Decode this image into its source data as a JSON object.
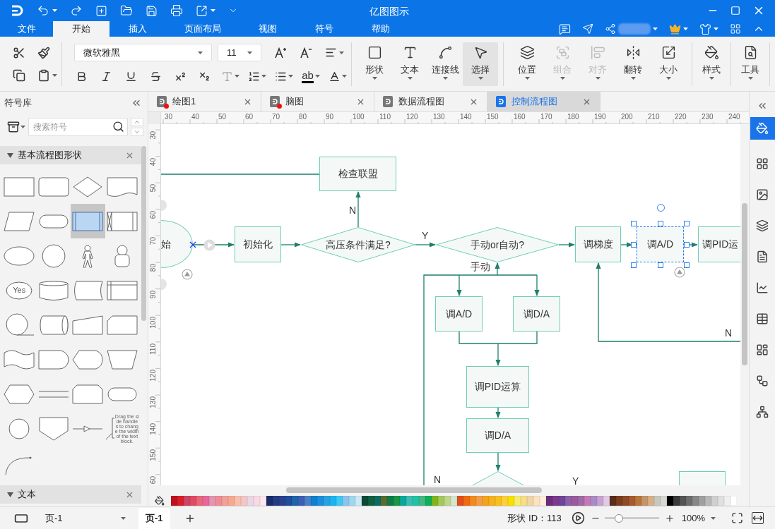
{
  "title_bar": {
    "title": "亿图图示"
  },
  "menu_tabs": [
    {
      "label": "文件",
      "selected": false
    },
    {
      "label": "开始",
      "selected": true
    },
    {
      "label": "插入",
      "selected": false
    },
    {
      "label": "页面布局",
      "selected": false
    },
    {
      "label": "视图",
      "selected": false
    },
    {
      "label": "符号",
      "selected": false
    },
    {
      "label": "帮助",
      "selected": false
    }
  ],
  "ribbon": {
    "font_family": "微软雅黑",
    "font_size": "11",
    "format_buttons": [
      {
        "kind": "bold",
        "disabled": false
      },
      {
        "kind": "italic",
        "disabled": false
      },
      {
        "kind": "underline",
        "disabled": false
      },
      {
        "kind": "strikethrough",
        "disabled": false
      },
      {
        "kind": "superscript",
        "disabled": false
      },
      {
        "kind": "subscript",
        "disabled": false
      },
      {
        "kind": "text-effect",
        "disabled": true
      },
      {
        "kind": "line-spacing",
        "disabled": false
      },
      {
        "kind": "bullets",
        "disabled": false
      },
      {
        "kind": "highlight",
        "label": "ab",
        "disabled": false
      },
      {
        "kind": "font-color",
        "disabled": false
      }
    ],
    "groups": [
      [
        {
          "label": "形状",
          "kind": "shape",
          "selected": false,
          "disabled": false
        },
        {
          "label": "文本",
          "kind": "text",
          "selected": false,
          "disabled": false
        },
        {
          "label": "连接线",
          "kind": "connector",
          "selected": false,
          "disabled": false
        },
        {
          "label": "选择",
          "kind": "select",
          "selected": true,
          "disabled": false
        }
      ],
      [
        {
          "label": "位置",
          "kind": "position",
          "selected": false,
          "disabled": false
        },
        {
          "label": "组合",
          "kind": "group",
          "selected": false,
          "disabled": true
        },
        {
          "label": "对齐",
          "kind": "align",
          "selected": false,
          "disabled": true
        },
        {
          "label": "翻转",
          "kind": "flip",
          "selected": false,
          "disabled": false
        },
        {
          "label": "大小",
          "kind": "size",
          "selected": false,
          "disabled": false
        }
      ],
      [
        {
          "label": "样式",
          "kind": "style",
          "selected": false,
          "disabled": false
        }
      ],
      [
        {
          "label": "工具",
          "kind": "tools",
          "selected": false,
          "disabled": false
        }
      ]
    ]
  },
  "library": {
    "title": "符号库",
    "search_placeholder": "搜索符号",
    "sections": [
      {
        "title": "基本流程图形状",
        "expanded": true,
        "shapes": [
          {
            "kind": "rect",
            "selected": false
          },
          {
            "kind": "rounded-rect",
            "selected": false
          },
          {
            "kind": "diamond",
            "selected": false
          },
          {
            "kind": "document",
            "selected": false
          },
          {
            "kind": "parallelogram",
            "selected": false
          },
          {
            "kind": "stadium",
            "selected": false
          },
          {
            "kind": "predefined",
            "selected": true
          },
          {
            "kind": "rect-x",
            "selected": false
          },
          {
            "kind": "ellipse",
            "selected": false
          },
          {
            "kind": "circle",
            "selected": false
          },
          {
            "kind": "stick-figure",
            "selected": false
          },
          {
            "kind": "person",
            "selected": false
          },
          {
            "kind": "labeled-ellipse",
            "label": "Yes",
            "selected": false
          },
          {
            "kind": "cylinder",
            "selected": false
          },
          {
            "kind": "curved-card",
            "selected": false
          },
          {
            "kind": "internal-storage",
            "selected": false
          },
          {
            "kind": "tail-circle",
            "selected": false
          },
          {
            "kind": "drum",
            "selected": false
          },
          {
            "kind": "manual-input",
            "selected": false
          },
          {
            "kind": "cut-corner",
            "selected": false
          },
          {
            "kind": "tape",
            "selected": false
          },
          {
            "kind": "delay",
            "selected": false
          },
          {
            "kind": "display",
            "selected": false
          },
          {
            "kind": "trapezoid",
            "selected": false
          },
          {
            "kind": "hexagon",
            "selected": false
          },
          {
            "kind": "double-line",
            "selected": false
          },
          {
            "kind": "loop-limit",
            "selected": false
          },
          {
            "kind": "stadium",
            "selected": false
          },
          {
            "kind": "small-circle",
            "selected": false
          },
          {
            "kind": "pentagon-down",
            "selected": false
          },
          {
            "kind": "arrow-line",
            "selected": false
          },
          {
            "kind": "annotation",
            "label": "Drag the side handles to change the width of the text block.",
            "selected": false
          },
          {
            "kind": "arc",
            "selected": false
          }
        ]
      },
      {
        "title": "文本",
        "expanded": true
      }
    ]
  },
  "doc_tabs": [
    {
      "label": "绘图1",
      "modified": true,
      "selected": false
    },
    {
      "label": "脑图",
      "modified": true,
      "selected": false
    },
    {
      "label": "数据流程图",
      "modified": false,
      "selected": false
    },
    {
      "label": "控制流程图",
      "modified": false,
      "selected": true
    }
  ],
  "rulers": {
    "horizontal": [
      "30",
      "40",
      "50",
      "60",
      "70",
      "80",
      "90",
      "100",
      "110",
      "120",
      "130",
      "140",
      "150",
      "160",
      "170",
      "180",
      "190",
      "200",
      "210",
      "220",
      "230",
      "240"
    ],
    "vertical": [
      "30",
      "40",
      "50",
      "60",
      "70",
      "80",
      "90",
      "100",
      "110",
      "120",
      "130",
      "140",
      "150",
      "60"
    ]
  },
  "canvas": {
    "nodes": [
      {
        "kind": "rect",
        "label": "检查联盟",
        "selected": false
      },
      {
        "kind": "terminator",
        "label": "始",
        "selected": false
      },
      {
        "kind": "rect",
        "label": "初始化",
        "selected": false
      },
      {
        "kind": "diamond",
        "label": "高压条件满足?",
        "selected": false
      },
      {
        "kind": "diamond",
        "label": "手动or自动?",
        "selected": false
      },
      {
        "kind": "rect",
        "label": "调梯度",
        "selected": false
      },
      {
        "kind": "rect",
        "label": "调A/D",
        "selected": true
      },
      {
        "kind": "rect",
        "label": "调PID运",
        "selected": false
      },
      {
        "kind": "rect",
        "label": "调A/D",
        "selected": false
      },
      {
        "kind": "rect",
        "label": "调D/A",
        "selected": false
      },
      {
        "kind": "rect",
        "label": "调PID运算",
        "selected": false
      },
      {
        "kind": "rect",
        "label": "调D/A",
        "selected": false
      },
      {
        "kind": "diamond",
        "selected": false
      },
      {
        "kind": "rect",
        "selected": false
      }
    ],
    "edge_labels": [
      "N",
      "Y",
      "手动",
      "N",
      "N",
      "Y"
    ]
  },
  "palette": [
    {
      "color": "#c0111f"
    },
    {
      "color": "#d81e2c"
    },
    {
      "color": "#cc4466"
    },
    {
      "color": "#e04a64"
    },
    {
      "color": "#e8677a"
    },
    {
      "color": "#e8669a"
    },
    {
      "color": "#e394b4"
    },
    {
      "color": "#ef8d94"
    },
    {
      "color": "#f3a09a"
    },
    {
      "color": "#f6a98c"
    },
    {
      "color": "#f7bfb0"
    },
    {
      "color": "#f4c6c6"
    },
    {
      "color": "#e9d7e8"
    },
    {
      "color": "#fbd9e2"
    },
    {
      "color": "#fde7ef"
    },
    {
      "color": "#1a2d6b"
    },
    {
      "color": "#233c84"
    },
    {
      "color": "#2b3f8f"
    },
    {
      "color": "#1e4e9c"
    },
    {
      "color": "#1f65a8"
    },
    {
      "color": "#3b5fb5"
    },
    {
      "color": "#4c80c5"
    },
    {
      "color": "#0f7fcf"
    },
    {
      "color": "#1b8fdc"
    },
    {
      "color": "#29a2e3"
    },
    {
      "color": "#1bb5ef"
    },
    {
      "color": "#3dc8f5"
    },
    {
      "color": "#8ec4ea"
    },
    {
      "color": "#9fd6f0"
    },
    {
      "color": "#cde9f5"
    },
    {
      "color": "#0d4a36"
    },
    {
      "color": "#11603f"
    },
    {
      "color": "#0c6b5e"
    },
    {
      "color": "#5a6b30"
    },
    {
      "color": "#0f7b45"
    },
    {
      "color": "#1a9446"
    },
    {
      "color": "#0aa89a"
    },
    {
      "color": "#3bbcb0"
    },
    {
      "color": "#22c2a6"
    },
    {
      "color": "#42b983"
    },
    {
      "color": "#0fae5a"
    },
    {
      "color": "#7fb61c"
    },
    {
      "color": "#a5c85a"
    },
    {
      "color": "#bfd68c"
    },
    {
      "color": "#cfe8d0"
    },
    {
      "color": "#e04e1c"
    },
    {
      "color": "#f06a10"
    },
    {
      "color": "#f28a1e"
    },
    {
      "color": "#f49c4a"
    },
    {
      "color": "#f4a31a"
    },
    {
      "color": "#f6b320"
    },
    {
      "color": "#f7c01e"
    },
    {
      "color": "#fcd03c"
    },
    {
      "color": "#f9e000"
    },
    {
      "color": "#f6ec6e"
    },
    {
      "color": "#f8dd8a"
    },
    {
      "color": "#f0d5a8"
    },
    {
      "color": "#fbe3c0"
    },
    {
      "color": "#fdf0dc"
    },
    {
      "color": "#6b2d7a"
    },
    {
      "color": "#7b3a8f"
    },
    {
      "color": "#6e4599"
    },
    {
      "color": "#8c5fa6"
    },
    {
      "color": "#9a5b9c"
    },
    {
      "color": "#a06aa6"
    },
    {
      "color": "#c47ab4"
    },
    {
      "color": "#a98bc8"
    },
    {
      "color": "#c6a4cf"
    },
    {
      "color": "#e2c9e6"
    },
    {
      "color": "#5a2d1a"
    },
    {
      "color": "#7b3c20"
    },
    {
      "color": "#8c4a25"
    },
    {
      "color": "#a65a2e"
    },
    {
      "color": "#b8753c"
    },
    {
      "color": "#c4956a"
    },
    {
      "color": "#d8b088"
    },
    {
      "color": "#c8c8c0"
    },
    {
      "color": "#d8d8d0"
    },
    {
      "color": "#000000"
    },
    {
      "color": "#3a3a3a"
    },
    {
      "color": "#555555"
    },
    {
      "color": "#6e6e6e"
    },
    {
      "color": "#888888"
    },
    {
      "color": "#a0a0a0"
    },
    {
      "color": "#b8b8b8"
    },
    {
      "color": "#d0d0d0"
    },
    {
      "color": "#e0e0e0"
    },
    {
      "color": "#f0f0f0"
    },
    {
      "color": "#ffffff"
    }
  ],
  "right_sidebar": [
    {
      "kind": "fill",
      "selected": true
    },
    {
      "kind": "grid",
      "selected": false
    },
    {
      "kind": "image",
      "selected": false
    },
    {
      "kind": "layers",
      "selected": false
    },
    {
      "kind": "document",
      "selected": false
    },
    {
      "kind": "chart",
      "selected": false
    },
    {
      "kind": "table",
      "selected": false
    },
    {
      "kind": "layout",
      "selected": false
    },
    {
      "kind": "connector",
      "selected": false
    },
    {
      "kind": "network",
      "selected": false
    }
  ],
  "status_bar": {
    "page_select": "页-1",
    "page_tabs": [
      {
        "label": "页-1",
        "selected": true
      }
    ],
    "shape_id": "形状 ID：113",
    "zoom": {
      "level": 0.26,
      "value": "100%"
    }
  }
}
